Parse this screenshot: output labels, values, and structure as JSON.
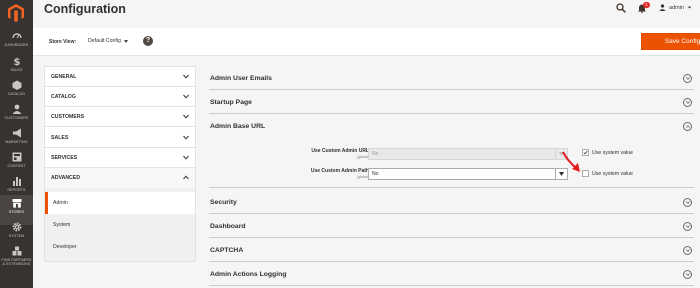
{
  "menu": {
    "items": [
      {
        "label": "DASHBOARD",
        "icon": "speedometer-icon"
      },
      {
        "label": "SALES",
        "icon": "dollar-icon"
      },
      {
        "label": "CATALOG",
        "icon": "cube-icon"
      },
      {
        "label": "CUSTOMERS",
        "icon": "person-icon"
      },
      {
        "label": "MARKETING",
        "icon": "megaphone-icon"
      },
      {
        "label": "CONTENT",
        "icon": "layout-icon"
      },
      {
        "label": "REPORTS",
        "icon": "bar-chart-icon"
      },
      {
        "label": "STORES",
        "icon": "store-icon"
      },
      {
        "label": "SYSTEM",
        "icon": "gear-icon"
      },
      {
        "label": "FIND PARTNERS & EXTENSIONS",
        "icon": "blocks-icon"
      }
    ]
  },
  "header": {
    "title": "Configuration",
    "notifications_count": "1",
    "user_name": "admin"
  },
  "toolbar": {
    "store_view_label": "Store View:",
    "store_view_value": "Default Config",
    "help": "?",
    "save_label": "Save Config"
  },
  "tabs": {
    "groups": [
      "GENERAL",
      "CATALOG",
      "CUSTOMERS",
      "SALES",
      "SERVICES",
      "ADVANCED"
    ],
    "advanced_items": [
      "Admin",
      "System",
      "Developer"
    ]
  },
  "sections": {
    "admin_user_emails": "Admin User Emails",
    "startup_page": "Startup Page",
    "admin_base_url": "Admin Base URL",
    "security": "Security",
    "dashboard": "Dashboard",
    "captcha": "CAPTCHA",
    "admin_actions_logging": "Admin Actions Logging"
  },
  "fields": {
    "custom_url": {
      "label": "Use Custom Admin URL",
      "scope": "[global]",
      "value": "No",
      "use_system_value": true,
      "checkbox_label": "Use system value"
    },
    "custom_path": {
      "label": "Use Custom Admin Path",
      "scope": "[global]",
      "value": "No",
      "use_system_value": false,
      "checkbox_label": "Use system value"
    }
  },
  "colors": {
    "accent": "#eb5202",
    "menu_bg": "#373330",
    "annotation_arrow": "#e02020"
  }
}
